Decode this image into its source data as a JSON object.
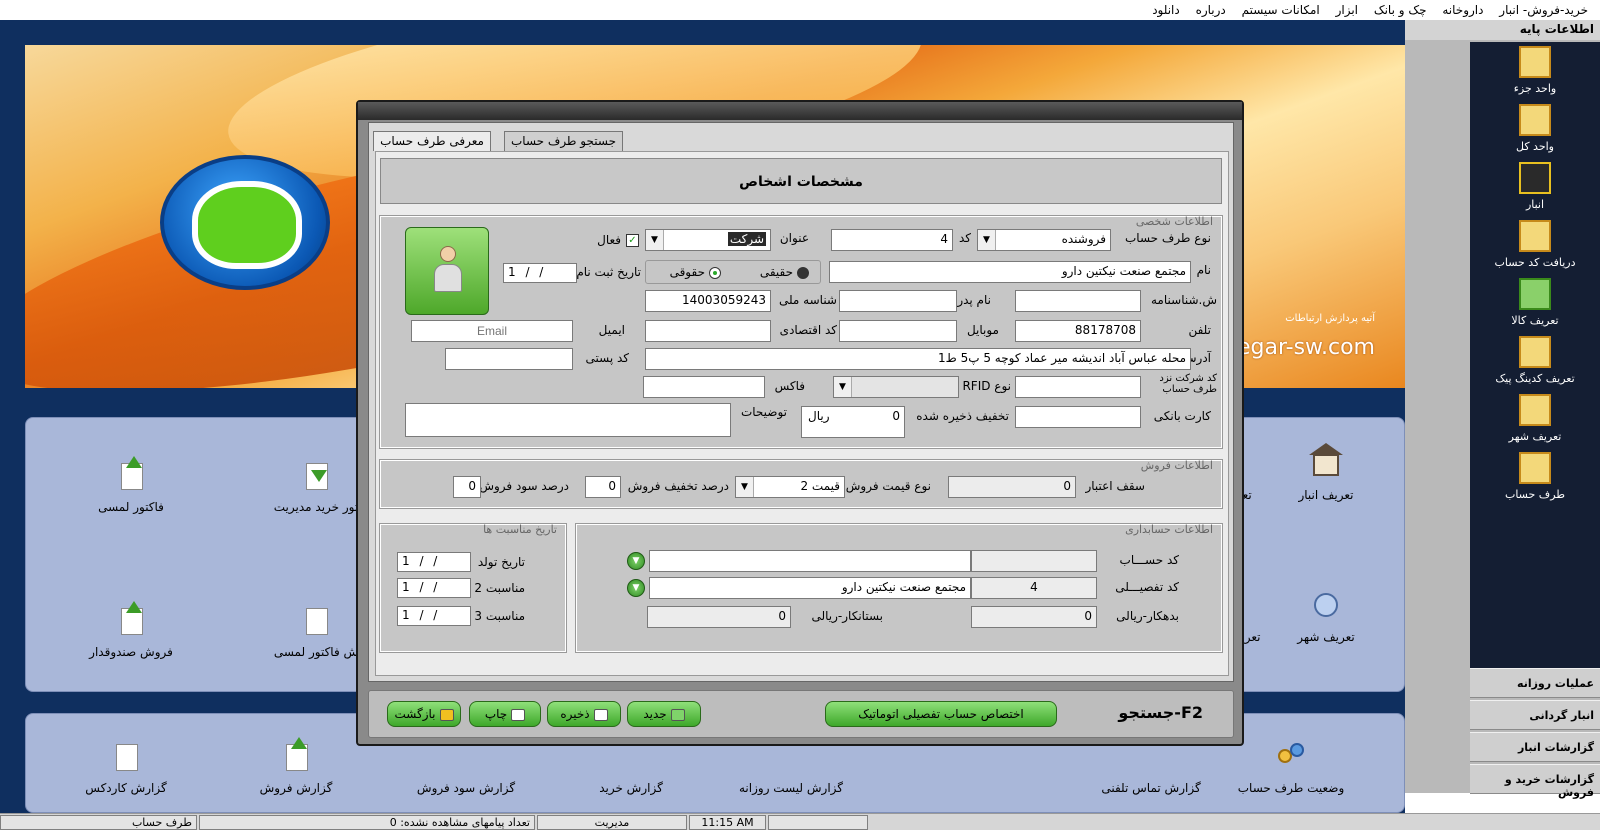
{
  "menubar": {
    "items": [
      "خرید-فروش- انبار",
      "داروخانه",
      "چک و بانک",
      "ابزار",
      "امکانات سیستم",
      "درباره",
      "دانلود"
    ]
  },
  "banner": {
    "url": "andegar-sw.com",
    "company_fa": "آتیه پردازش ارتباطات"
  },
  "desktop": {
    "panel1_icons": [
      {
        "label": "فاکتور لمسی"
      },
      {
        "label": "تور خرید مدیریت"
      },
      {
        "label": "تعریف کالا"
      },
      {
        "label": "تعریف انبار"
      },
      {
        "label": "فروش صندوقدار"
      },
      {
        "label": "ش فاکتور لمسی"
      },
      {
        "label": "تعریف سال م"
      },
      {
        "label": "تعریف شهر"
      }
    ],
    "panel2_icons": [
      {
        "label": "گزارش کاردکس"
      },
      {
        "label": "گزارش فروش"
      },
      {
        "label": "گزارش سود فروش"
      },
      {
        "label": "گزارش خرید"
      },
      {
        "label": "گزارش لیست روزانه"
      },
      {
        "label": "گزارش تماس تلفنی"
      },
      {
        "label": "وضعیت طرف حساب"
      }
    ]
  },
  "sidebar": {
    "header": "اطلاعات پایه",
    "items": [
      {
        "label": "واحد جزء"
      },
      {
        "label": "واحد کل"
      },
      {
        "label": "انبار"
      },
      {
        "label": "دریافت کد حساب"
      },
      {
        "label": "تعریف کالا"
      },
      {
        "label": "تعریف کدینگ پیک"
      },
      {
        "label": "تعریف شهر"
      },
      {
        "label": "طرف حساب"
      }
    ],
    "sections": [
      "عملیات روزانه",
      "انبار گردانی",
      "گزارشات انبار",
      "گزارشات خرید و فروش"
    ]
  },
  "statusbar": {
    "form": "طرف حساب",
    "unread": "تعداد پیامهای مشاهده نشده: 0",
    "user": "مدیریت",
    "time": "11:15 AM"
  },
  "dialog": {
    "tabs": [
      "معرفی طرف حساب",
      "جستجو طرف حساب"
    ],
    "header": "مشخصات اشخاص",
    "personal": {
      "title": "اطلاعات شخصی",
      "account_type_label": "نوع طرف حساب",
      "account_type_value": "فروشنده",
      "code_label": "کد",
      "code_value": "4",
      "title_label": "عنوان",
      "title_value": "شرکت",
      "active_label": "فعال",
      "active_checked": true,
      "name_label": "نام",
      "name_value": "مجتمع صنعت نیکتین دارو",
      "real_label": "حقیقی",
      "legal_label": "حقوقی",
      "reg_date_label": "تاریخ ثبت نام",
      "reg_date_value": "1  /  /",
      "idno_label": "ش.شناسنامه",
      "father_label": "نام پدر",
      "national_label": "شناسه ملی",
      "national_value": "14003059243",
      "phone_label": "تلفن",
      "phone_value": "88178708",
      "mobile_label": "موبایل",
      "economic_label": "کد اقتصادی",
      "email_label": "ایمیل",
      "email_placeholder": "Email",
      "address_label": "آدرس",
      "address_value": "محله عباس آباد اندیشه مير عماد کوچه 5 پ5 ط1",
      "postal_label": "کد پستی",
      "company_code_label": "کد شرکت نزد طرف حساب",
      "rfid_label": "نوع RFID",
      "fax_label": "فاکس",
      "bankcard_label": "کارت بانکی",
      "saved_discount_label": "تخفیف ذخیره شده",
      "saved_discount_value": "0",
      "saved_discount_unit": "ریال",
      "notes_label": "توضیحات"
    },
    "sales": {
      "title": "اطلاعات فروش",
      "credit_label": "سقف اعتبار",
      "credit_value": "0",
      "price_type_label": "نوع قیمت فروش",
      "price_type_value": "قیمت 2",
      "discount_label": "درصد تخفیف  فروش",
      "discount_value": "0",
      "profit_label": "درصد سود فروش",
      "profit_value": "0"
    },
    "accounting": {
      "title": "اطلاعات حسابداری",
      "account_code_label": "کد حســـاب",
      "detail_code_label": "کد تفصیـــلی",
      "detail_code_value": "4",
      "detail_name_value": "مجتمع صنعت نیکتین دارو",
      "debit_label": "بدهکار-ریالی",
      "debit_value": "0",
      "credit_label": "بستانکار-ریالی",
      "credit_value": "0"
    },
    "occasions": {
      "title": "تاریخ مناسبت ها",
      "birth_label": "تاریخ تولد",
      "occ2_label": "مناسبت 2",
      "occ3_label": "مناسبت 3",
      "date_value": "1  /  /"
    },
    "buttons": {
      "search": "F2-جستجو",
      "auto_assign": "اختصاص حساب تفصیلی اتوماتیک",
      "new": "جدید",
      "save": "ذخیره",
      "print": "چاپ",
      "back": "بازگشت"
    }
  }
}
